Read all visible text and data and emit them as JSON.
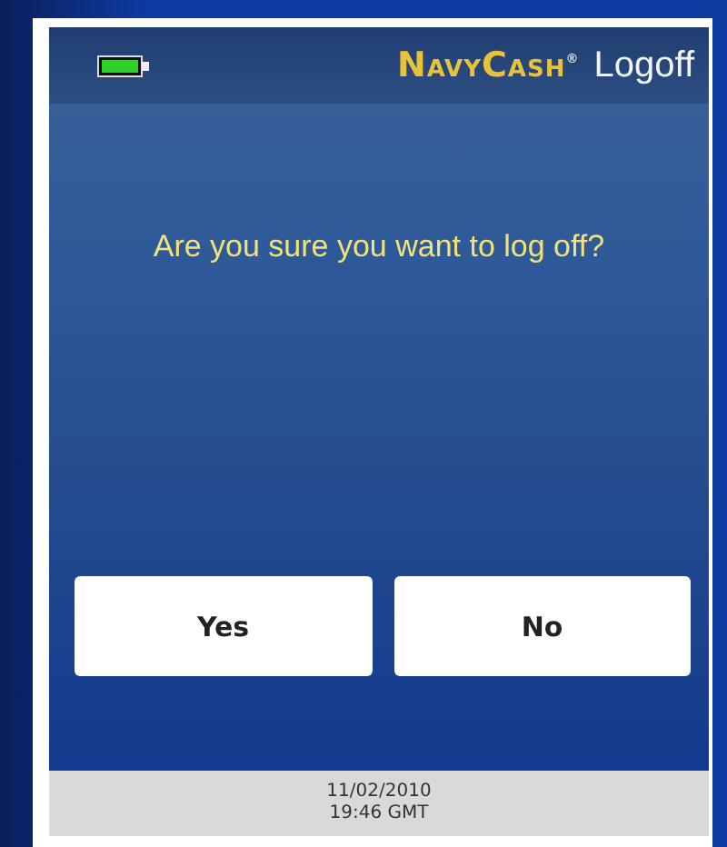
{
  "header": {
    "logo": "NavyCash$^{®}$",
    "title": "Logoff"
  },
  "message": "Are you sure you want to log off?",
  "buttons": [
    {
      "label": "Yes"
    },
    {
      "label": "No"
    }
  ],
  "status_bar": {
    "date": "11/02/2010",
    "time": "19:46 GMT"
  }
}
